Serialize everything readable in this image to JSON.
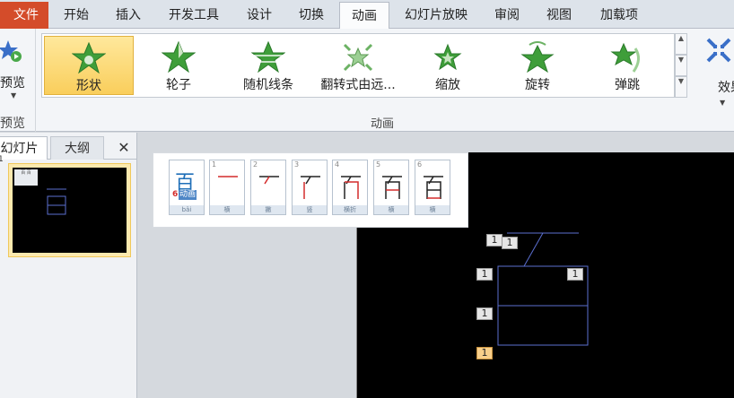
{
  "tabs": {
    "file": "文件",
    "items": [
      "开始",
      "插入",
      "开发工具",
      "设计",
      "切换",
      "动画",
      "幻灯片放映",
      "审阅",
      "视图",
      "加载项"
    ],
    "active": "动画"
  },
  "ribbon": {
    "preview_label": "预览",
    "preview_group_label": "预览",
    "animation_group_label": "动画",
    "gallery": [
      "形状",
      "轮子",
      "随机线条",
      "翻转式由远...",
      "缩放",
      "旋转",
      "弹跳"
    ],
    "selected_effect": "形状",
    "effect_options_label": "效果选",
    "icons": [
      "preview-star-icon",
      "shape-star-icon",
      "wheel-star-icon",
      "random-bars-star-icon",
      "float-star-icon",
      "zoom-star-icon",
      "spin-star-icon",
      "bounce-star-icon",
      "effect-options-icon"
    ]
  },
  "panel": {
    "tab_slides": "幻灯片",
    "tab_outline": "大纲",
    "close": "✕",
    "thumb_number": "1"
  },
  "popup": {
    "char": "百",
    "stroke_count": "6",
    "anim_tag": "动画",
    "pinyin": "bǎi",
    "cards": [
      {
        "num": "1",
        "label": "横"
      },
      {
        "num": "2",
        "label": "撇"
      },
      {
        "num": "3",
        "label": "竖"
      },
      {
        "num": "4",
        "label": "横折"
      },
      {
        "num": "5",
        "label": "横"
      },
      {
        "num": "6",
        "label": "横"
      }
    ]
  },
  "slide_tags": [
    "1",
    "1",
    "1",
    "1",
    "1",
    "1"
  ],
  "colors": {
    "file_tab": "#d44c2a",
    "selected_gallery": "#fcdd7e",
    "star_green": "#3f9e3a",
    "stroke_line": "#5b6fd0",
    "highlight_tag": "#f8cf8a"
  }
}
